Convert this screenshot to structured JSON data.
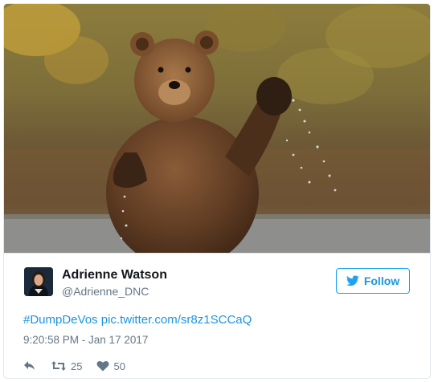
{
  "tweet": {
    "author_name": "Adrienne Watson",
    "author_handle": "@Adrienne_DNC",
    "follow_label": "Follow",
    "hashtag": "#DumpDeVos",
    "pic_link": "pic.twitter.com/sr8z1SCCaQ",
    "timestamp": "9:20:58 PM - Jan 17 2017",
    "retweet_count": "25",
    "like_count": "50"
  },
  "icons": {
    "reply": "reply-icon",
    "retweet": "retweet-icon",
    "like": "heart-icon",
    "follow": "twitter-bird-icon"
  },
  "colors": {
    "link": "#1b95e0",
    "meta": "#657786",
    "name": "#14171a",
    "border": "#e1e8ed"
  }
}
